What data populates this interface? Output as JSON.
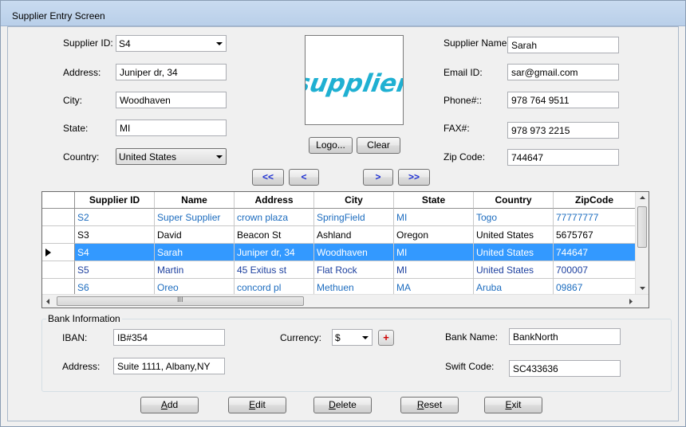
{
  "window": {
    "title": "Supplier Entry Screen"
  },
  "form": {
    "supplier_id": {
      "label": "Supplier ID:",
      "value": "S4"
    },
    "address": {
      "label": "Address:",
      "value": "Juniper dr, 34"
    },
    "city": {
      "label": "City:",
      "value": "Woodhaven"
    },
    "state": {
      "label": "State:",
      "value": "MI"
    },
    "country": {
      "label": "Country:",
      "value": "United States"
    },
    "supplier_name": {
      "label": "Supplier Name:",
      "value": "Sarah"
    },
    "email": {
      "label": "Email ID:",
      "value": "sar@gmail.com"
    },
    "phone": {
      "label": "Phone#::",
      "value": "978 764 9511"
    },
    "fax": {
      "label": "FAX#:",
      "value": "978 973 2215"
    },
    "zip": {
      "label": "Zip Code:",
      "value": "744647"
    },
    "logo_text": "supplier",
    "logo_button": "Logo...",
    "clear_button": "Clear"
  },
  "nav": {
    "first": "<<",
    "prev": "<",
    "next": ">",
    "last": ">>"
  },
  "grid": {
    "columns": [
      "Supplier ID",
      "Name",
      "Address",
      "City",
      "State",
      "Country",
      "ZipCode"
    ],
    "rows": [
      {
        "cells": [
          "S2",
          "Super Supplier",
          "crown plaza",
          "SpringField",
          "MI",
          "Togo",
          "77777777"
        ]
      },
      {
        "cells": [
          "S3",
          "David",
          "Beacon St",
          "Ashland",
          "Oregon",
          "United States",
          "5675767"
        ]
      },
      {
        "cells": [
          "S4",
          "Sarah",
          "Juniper dr, 34",
          "Woodhaven",
          "MI",
          "United States",
          "744647"
        ]
      },
      {
        "cells": [
          "S5",
          "Martin",
          "45 Exitus st",
          "Flat Rock",
          "MI",
          "United States",
          "700007"
        ]
      },
      {
        "cells": [
          "S6",
          "Oreo",
          "concord pl",
          "Methuen",
          "MA",
          "Aruba",
          "09867"
        ]
      }
    ],
    "hscroll_grip": "III"
  },
  "bank": {
    "title": "Bank Information",
    "iban": {
      "label": "IBAN:",
      "value": "IB#354"
    },
    "currency": {
      "label": "Currency:",
      "value": "$"
    },
    "add_currency": "+",
    "bank_name": {
      "label": "Bank Name:",
      "value": "BankNorth"
    },
    "address": {
      "label": "Address:",
      "value": "Suite 1111, Albany,NY"
    },
    "swift": {
      "label": "Swift Code:",
      "value": "SC433636"
    }
  },
  "actions": {
    "add": {
      "hotkey": "A",
      "rest": "dd"
    },
    "edit": {
      "hotkey": "E",
      "rest": "dit"
    },
    "delete": {
      "hotkey": "D",
      "rest": "elete"
    },
    "reset": {
      "hotkey": "R",
      "rest": "eset"
    },
    "exit": {
      "hotkey": "E",
      "rest": "xit"
    }
  }
}
